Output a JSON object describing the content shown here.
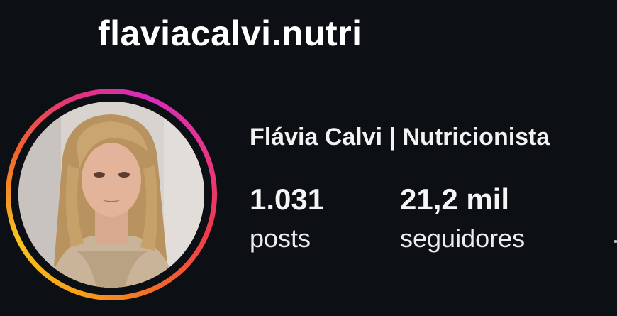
{
  "profile": {
    "username": "flaviacalvi.nutri",
    "full_name": "Flávia Calvi | Nutricionista",
    "avatar_ring_colors": [
      "#d62cbe",
      "#f0394f",
      "#f8a219"
    ]
  },
  "stats": [
    {
      "value": "1.031",
      "label": "posts"
    },
    {
      "value": "21,2 mil",
      "label": "seguidores"
    }
  ],
  "theme": {
    "background": "#0c0f14",
    "text": "#f5f5f5"
  }
}
